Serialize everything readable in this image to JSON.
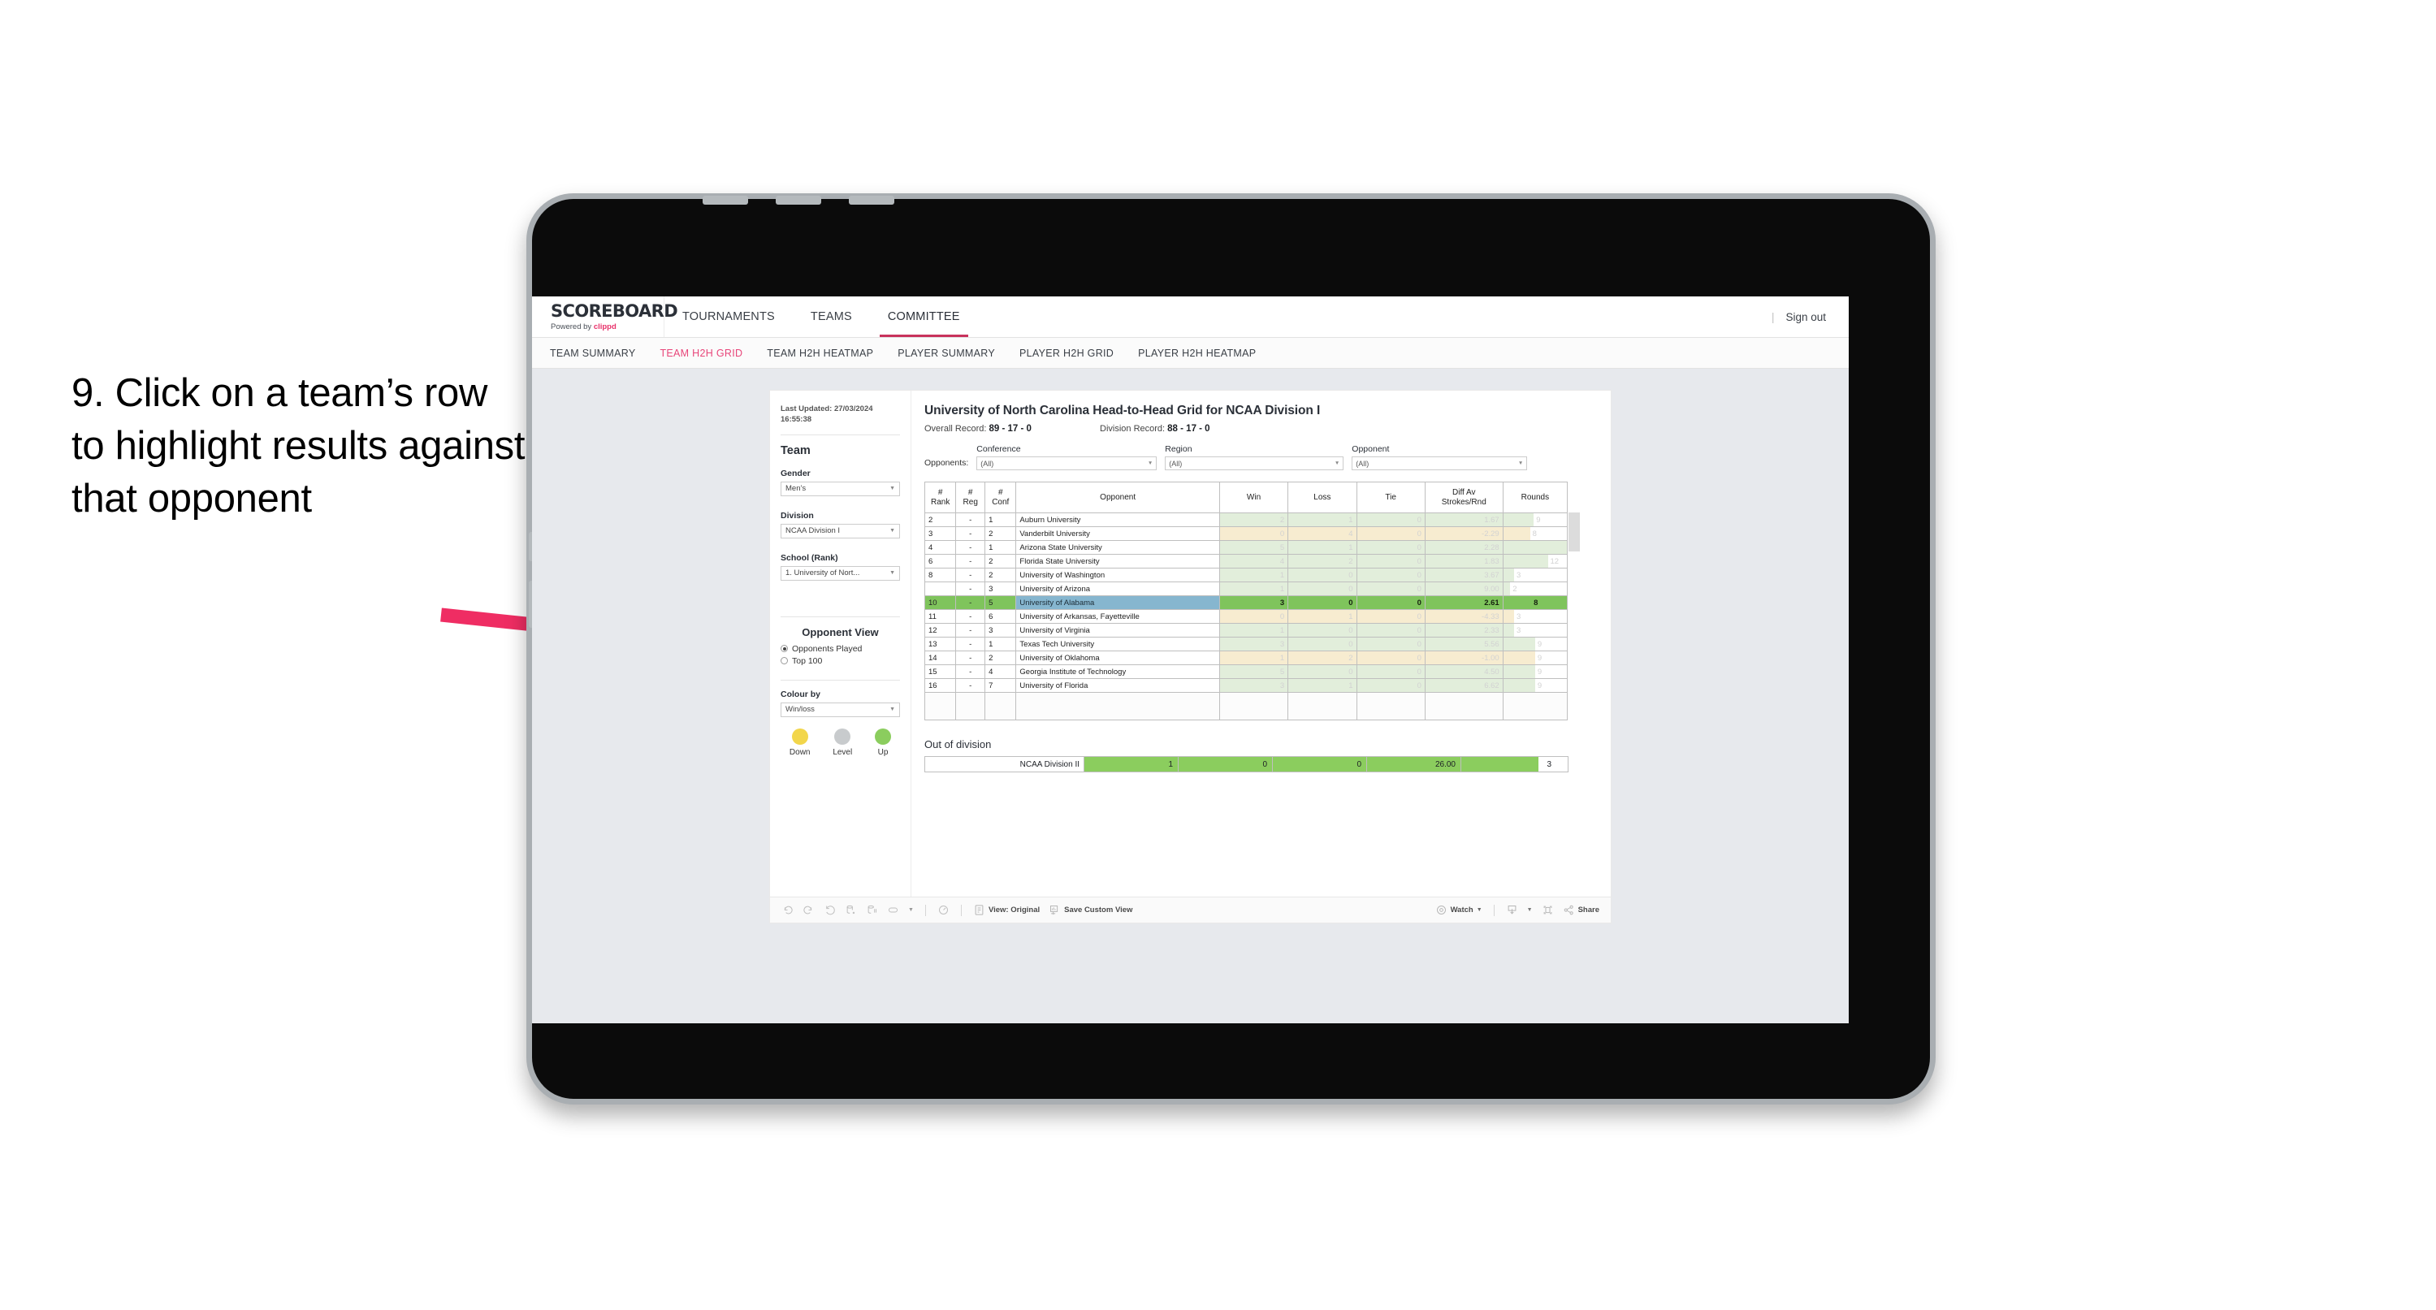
{
  "caption": "9. Click on a team’s row to highlight results against that opponent",
  "accent": "#e8316a",
  "topbar": {
    "brand_title": "SCOREBOARD",
    "brand_prefix": "Powered by ",
    "brand_suffix": "clippd",
    "nav": [
      {
        "label": "TOURNAMENTS",
        "active": false
      },
      {
        "label": "TEAMS",
        "active": false
      },
      {
        "label": "COMMITTEE",
        "active": true
      }
    ],
    "divider": "|",
    "signout": "Sign out"
  },
  "subnav": [
    {
      "label": "TEAM SUMMARY",
      "active": false
    },
    {
      "label": "TEAM H2H GRID",
      "active": true
    },
    {
      "label": "TEAM H2H HEATMAP",
      "active": false
    },
    {
      "label": "PLAYER SUMMARY",
      "active": false
    },
    {
      "label": "PLAYER H2H GRID",
      "active": false
    },
    {
      "label": "PLAYER H2H HEATMAP",
      "active": false
    }
  ],
  "sidebar": {
    "last_updated": "Last Updated: 27/03/2024 16:55:38",
    "team_heading": "Team",
    "gender_label": "Gender",
    "gender_value": "Men’s",
    "division_label": "Division",
    "division_value": "NCAA Division I",
    "school_label": "School (Rank)",
    "school_value": "1. University of Nort...",
    "opponent_view_heading": "Opponent View",
    "radio_options": [
      {
        "label": "Opponents Played",
        "selected": true
      },
      {
        "label": "Top 100",
        "selected": false
      }
    ],
    "colour_by_label": "Colour by",
    "colour_by_value": "Win/loss",
    "legend": [
      {
        "label": "Down",
        "color": "#f2d64b"
      },
      {
        "label": "Level",
        "color": "#c8cbcd"
      },
      {
        "label": "Up",
        "color": "#8bcd5e"
      }
    ]
  },
  "main": {
    "title": "University of North Carolina Head-to-Head Grid for NCAA Division I",
    "overall_record_label": "Overall Record:",
    "overall_record_value": "89 - 17 - 0",
    "division_record_label": "Division Record:",
    "division_record_value": "88 - 17 - 0",
    "opponents_label": "Opponents:",
    "filters": [
      {
        "label": "Conference",
        "value": "(All)"
      },
      {
        "label": "Region",
        "value": "(All)"
      },
      {
        "label": "Opponent",
        "value": "(All)"
      }
    ],
    "columns": [
      "# Rank",
      "# Reg",
      "# Conf",
      "Opponent",
      "Win",
      "Loss",
      "Tie",
      "Diff Av Strokes/Rnd",
      "Rounds"
    ],
    "column_lines": [
      [
        "#",
        "Rank"
      ],
      [
        "#",
        "Reg"
      ],
      [
        "#",
        "Conf"
      ],
      [
        "",
        "Opponent"
      ],
      [
        "",
        "Win"
      ],
      [
        "",
        "Loss"
      ],
      [
        "",
        "Tie"
      ],
      [
        "Diff Av",
        "Strokes/Rnd"
      ],
      [
        "",
        "Rounds"
      ]
    ],
    "out_of_division_heading": "Out of division",
    "out_of_division": {
      "name": "NCAA Division II",
      "win": "1",
      "loss": "0",
      "tie": "0",
      "diff": "26.00",
      "rounds": "3"
    }
  },
  "chart_data": {
    "type": "table",
    "title": "University of North Carolina Head-to-Head Grid for NCAA Division I",
    "columns": [
      "# Rank",
      "# Reg",
      "# Conf",
      "Opponent",
      "Win",
      "Loss",
      "Tie",
      "Diff Av Strokes/Rnd",
      "Rounds"
    ],
    "rows": [
      {
        "rank": "2",
        "reg": "-",
        "conf": "1",
        "opponent": "Auburn University",
        "win": "2",
        "loss": "1",
        "tie": "0",
        "diff": "1.67",
        "rounds": "9",
        "tone": "green",
        "selected": false,
        "rounds_pct": 48
      },
      {
        "rank": "3",
        "reg": "-",
        "conf": "2",
        "opponent": "Vanderbilt University",
        "win": "0",
        "loss": "4",
        "tie": "0",
        "diff": "-2.29",
        "rounds": "8",
        "tone": "yellow",
        "selected": false,
        "rounds_pct": 42
      },
      {
        "rank": "4",
        "reg": "-",
        "conf": "1",
        "opponent": "Arizona State University",
        "win": "5",
        "loss": "1",
        "tie": "0",
        "diff": "2.28",
        "rounds": "17",
        "tone": "green",
        "selected": false,
        "rounds_pct": 100
      },
      {
        "rank": "6",
        "reg": "-",
        "conf": "2",
        "opponent": "Florida State University",
        "win": "4",
        "loss": "2",
        "tie": "0",
        "diff": "1.83",
        "rounds": "12",
        "tone": "green",
        "selected": false,
        "rounds_pct": 70
      },
      {
        "rank": "8",
        "reg": "-",
        "conf": "2",
        "opponent": "University of Washington",
        "win": "1",
        "loss": "0",
        "tie": "0",
        "diff": "3.67",
        "rounds": "3",
        "tone": "green",
        "selected": false,
        "rounds_pct": 17
      },
      {
        "rank": "",
        "reg": "-",
        "conf": "3",
        "opponent": "University of Arizona",
        "win": "1",
        "loss": "0",
        "tie": "0",
        "diff": "9.00",
        "rounds": "2",
        "tone": "green",
        "selected": false,
        "rounds_pct": 11
      },
      {
        "rank": "10",
        "reg": "-",
        "conf": "5",
        "opponent": "University of Alabama",
        "win": "3",
        "loss": "0",
        "tie": "0",
        "diff": "2.61",
        "rounds": "8",
        "tone": "green",
        "selected": true,
        "rounds_pct": 44
      },
      {
        "rank": "11",
        "reg": "-",
        "conf": "6",
        "opponent": "University of Arkansas, Fayetteville",
        "win": "0",
        "loss": "1",
        "tie": "0",
        "diff": "-4.33",
        "rounds": "3",
        "tone": "yellow",
        "selected": false,
        "rounds_pct": 17
      },
      {
        "rank": "12",
        "reg": "-",
        "conf": "3",
        "opponent": "University of Virginia",
        "win": "1",
        "loss": "0",
        "tie": "0",
        "diff": "2.33",
        "rounds": "3",
        "tone": "green",
        "selected": false,
        "rounds_pct": 17
      },
      {
        "rank": "13",
        "reg": "-",
        "conf": "1",
        "opponent": "Texas Tech University",
        "win": "3",
        "loss": "0",
        "tie": "0",
        "diff": "5.56",
        "rounds": "9",
        "tone": "green",
        "selected": false,
        "rounds_pct": 50
      },
      {
        "rank": "14",
        "reg": "-",
        "conf": "2",
        "opponent": "University of Oklahoma",
        "win": "1",
        "loss": "2",
        "tie": "0",
        "diff": "-1.00",
        "rounds": "9",
        "tone": "yellow",
        "selected": false,
        "rounds_pct": 50
      },
      {
        "rank": "15",
        "reg": "-",
        "conf": "4",
        "opponent": "Georgia Institute of Technology",
        "win": "5",
        "loss": "0",
        "tie": "0",
        "diff": "4.50",
        "rounds": "9",
        "tone": "green",
        "selected": false,
        "rounds_pct": 50
      },
      {
        "rank": "16",
        "reg": "-",
        "conf": "7",
        "opponent": "University of Florida",
        "win": "3",
        "loss": "1",
        "tie": "0",
        "diff": "6.62",
        "rounds": "9",
        "tone": "green",
        "selected": false,
        "rounds_pct": 50
      }
    ]
  },
  "toolbar": {
    "view_label": "View: Original",
    "save_label": "Save Custom View",
    "watch_label": "Watch",
    "share_label": "Share"
  }
}
